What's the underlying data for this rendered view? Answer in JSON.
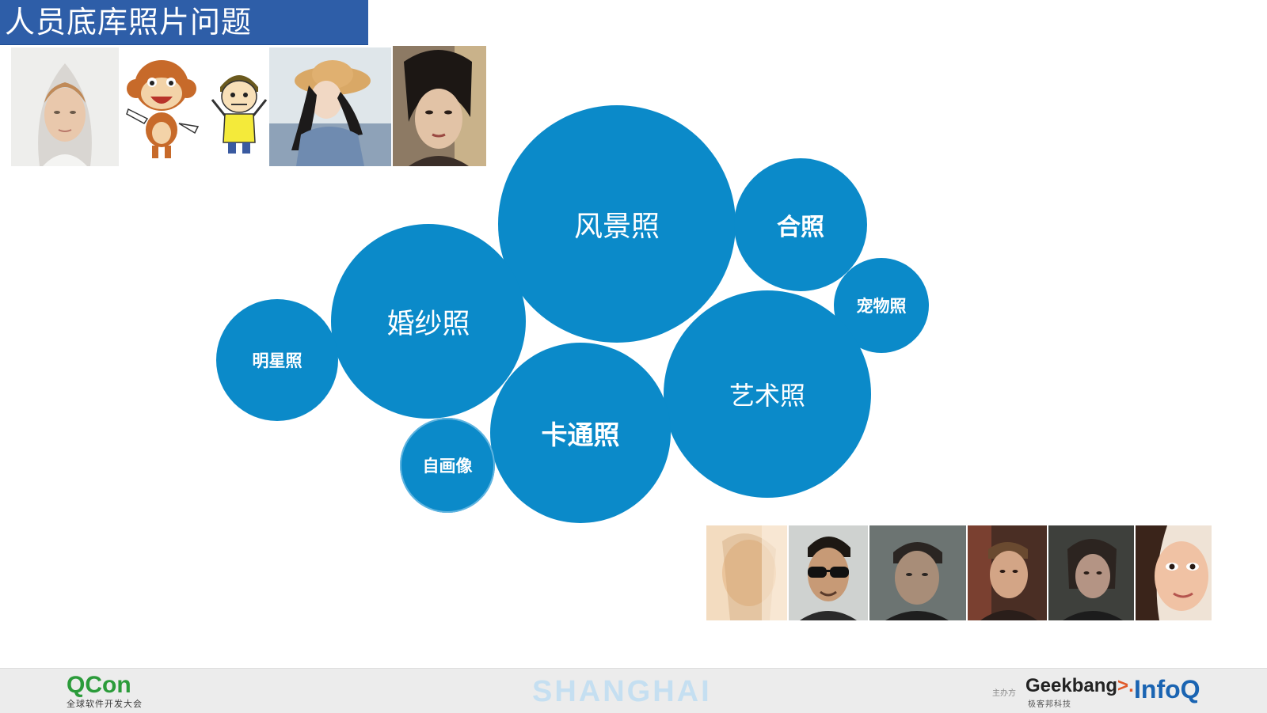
{
  "slide": {
    "title": "人员底库照片问题"
  },
  "categories": [
    {
      "key": "landscape",
      "label": "风景照"
    },
    {
      "key": "group",
      "label": "合照"
    },
    {
      "key": "pet",
      "label": "宠物照"
    },
    {
      "key": "wedding",
      "label": "婚纱照"
    },
    {
      "key": "celebrity",
      "label": "明星照"
    },
    {
      "key": "art",
      "label": "艺术照"
    },
    {
      "key": "cartoon",
      "label": "卡通照"
    },
    {
      "key": "selfportrait",
      "label": "自画像"
    }
  ],
  "colors": {
    "title_bar": "#2e5ea8",
    "bubble": "#0b8ac9",
    "footer": "#ececec"
  },
  "top_photos": [
    "bride-photo",
    "cartoon-monkey-image",
    "cartoon-boy-image",
    "girl-straw-hat-photo",
    "woman-portrait-photo"
  ],
  "bottom_photos": [
    "blurred-woman-photo",
    "man-sunglasses-photo",
    "man-dim-photo",
    "man-scene-photo",
    "woman-dark-photo",
    "girl-closeup-photo"
  ],
  "footer": {
    "brand": "QCon",
    "brand_sub": "全球软件开发大会",
    "city": "SHANGHAI",
    "organizer_label": "主办方",
    "sponsor1": "Geekbang",
    "sponsor1_arrow": ">.",
    "sponsor1_sub": "极客邦科技",
    "sponsor2": "InfoQ"
  }
}
